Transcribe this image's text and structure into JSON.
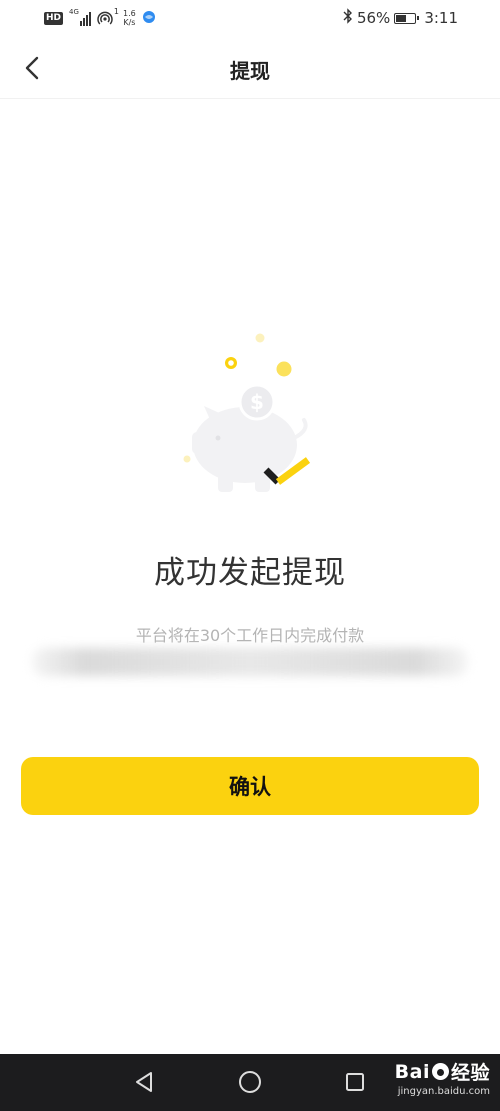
{
  "status_bar": {
    "hd_label": "HD",
    "network_type": "4G",
    "wifi_badge": "1",
    "speed_value": "1.6",
    "speed_unit": "K/s",
    "battery_percent": "56%",
    "battery_level": 0.56,
    "time": "3:11"
  },
  "header": {
    "title": "提现"
  },
  "main": {
    "success_title": "成功发起提现",
    "success_subtitle": "平台将在30个工作日内完成付款",
    "confirm_label": "确认"
  },
  "watermark": {
    "logo_text_left": "Bai",
    "logo_text_right": "经验",
    "url": "jingyan.baidu.com"
  },
  "colors": {
    "accent_yellow": "#fbd20f",
    "status_text": "#333333",
    "subtitle_gray": "#b4b4b4",
    "system_nav_bg": "#1c1c1e"
  }
}
